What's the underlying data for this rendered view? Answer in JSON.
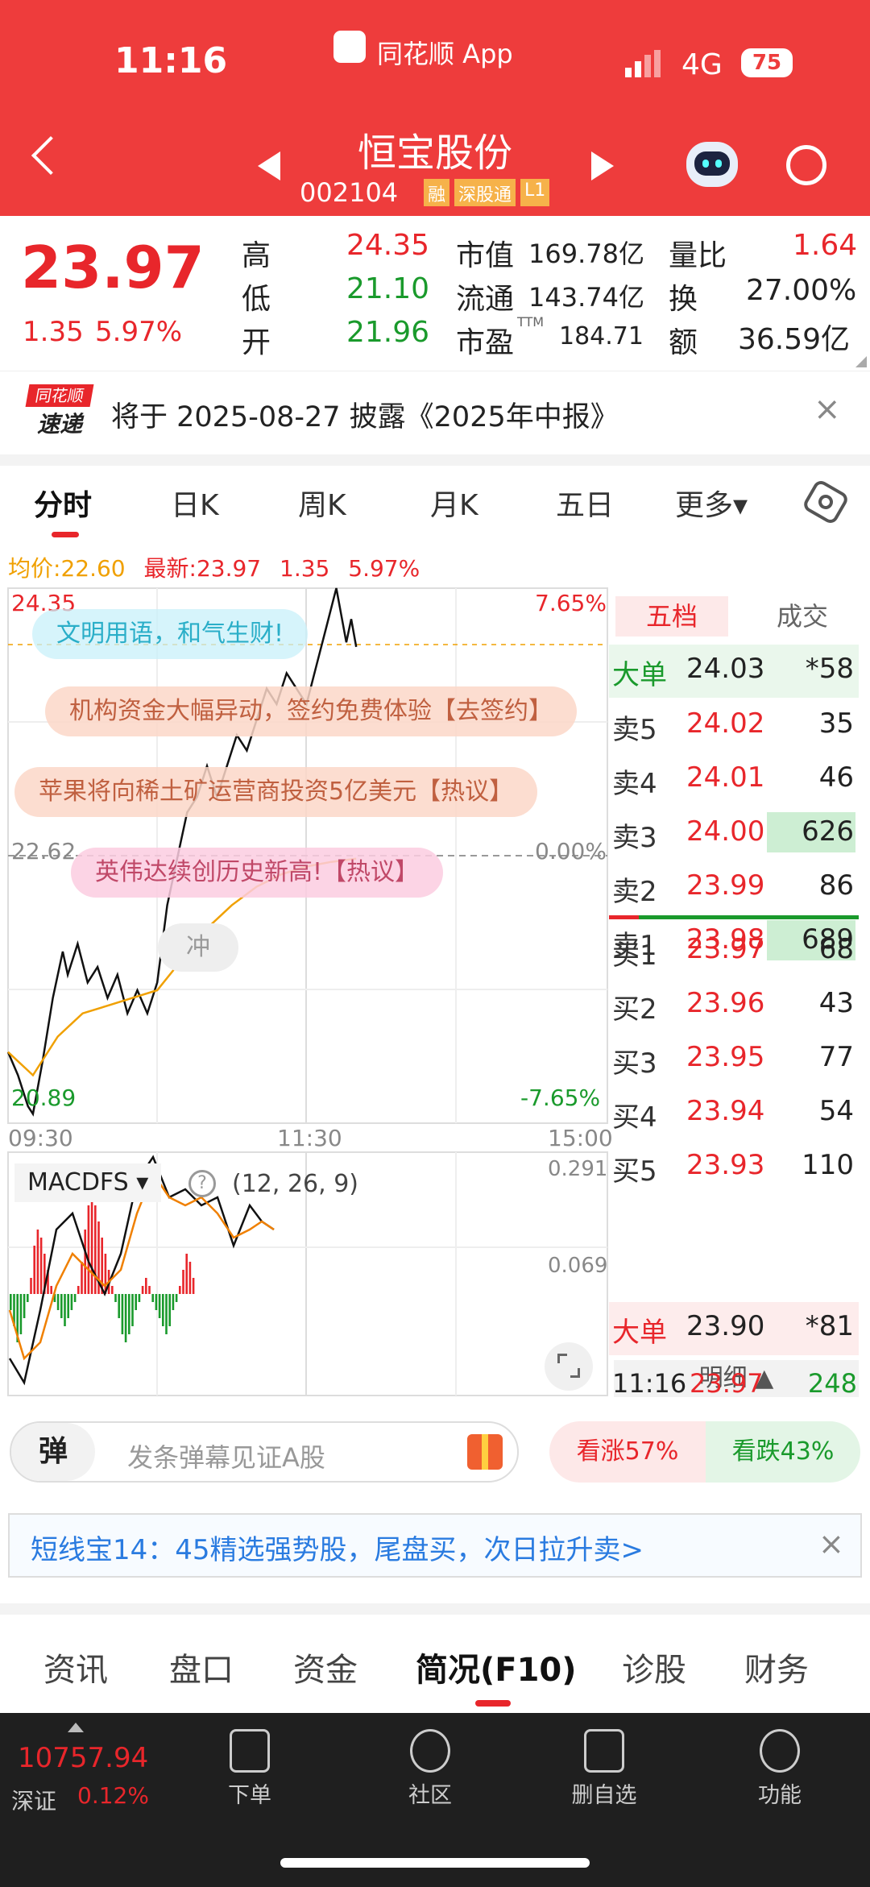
{
  "status": {
    "time": "11:16",
    "app": "同花顺 App",
    "network": "4G",
    "battery": "75"
  },
  "stock": {
    "name": "恒宝股份",
    "code": "002104",
    "tags": [
      "融",
      "深股通",
      "L1"
    ]
  },
  "quote": {
    "price": "23.97",
    "change": "1.35",
    "pct": "5.97%",
    "high_l": "高",
    "high": "24.35",
    "low_l": "低",
    "low": "21.10",
    "open_l": "开",
    "open": "21.96",
    "mcap_l": "市值",
    "mcap": "169.78亿",
    "float_l": "流通",
    "float": "143.74亿",
    "pe_l": "市盈",
    "pe_sup": "TTM",
    "pe": "184.71",
    "vr_l": "量比",
    "vr": "1.64",
    "turn_l": "换",
    "turn": "27.00%",
    "amt_l": "额",
    "amt": "36.59亿"
  },
  "notice": {
    "logo1": "同花顺",
    "logo2": "速递",
    "text": "将于 2025-08-27 披露《2025年中报》",
    "close": "×"
  },
  "tabs": [
    "分时",
    "日K",
    "周K",
    "月K",
    "五日",
    "更多▾"
  ],
  "info": {
    "avg_l": "均价:",
    "avg": "22.60",
    "latest_l": "最新:",
    "latest": "23.97",
    "chg": "1.35",
    "pct": "5.97%"
  },
  "chart": {
    "ymax": "24.35",
    "ymid": "22.62",
    "ymin": "20.89",
    "pmax": "7.65%",
    "pmid": "0.00%",
    "pmin": "-7.65%",
    "t0": "09:30",
    "t1": "11:30",
    "t2": "15:00",
    "chong": "冲"
  },
  "bubbles": [
    "文明用语，和气生财!",
    "机构资金大幅异动，签约免费体验【去签约】",
    "苹果将向稀土矿运营商投资5亿美元【热议】",
    "英伟达续创历史新高!【热议】"
  ],
  "macd": {
    "name": "MACDFS",
    "params": "(12, 26, 9)",
    "v1": "0.291",
    "v2": "0.069"
  },
  "orderbook": {
    "tab1": "五档",
    "tab2": "成交",
    "big_sell": {
      "l": "大单",
      "p": "24.03",
      "v": "*58"
    },
    "sells": [
      {
        "l": "卖5",
        "p": "24.02",
        "v": "35"
      },
      {
        "l": "卖4",
        "p": "24.01",
        "v": "46"
      },
      {
        "l": "卖3",
        "p": "24.00",
        "v": "626"
      },
      {
        "l": "卖2",
        "p": "23.99",
        "v": "86"
      },
      {
        "l": "卖1",
        "p": "23.98",
        "v": "689"
      }
    ],
    "buys": [
      {
        "l": "买1",
        "p": "23.97",
        "v": "68"
      },
      {
        "l": "买2",
        "p": "23.96",
        "v": "43"
      },
      {
        "l": "买3",
        "p": "23.95",
        "v": "77"
      },
      {
        "l": "买4",
        "p": "23.94",
        "v": "54"
      },
      {
        "l": "买5",
        "p": "23.93",
        "v": "110"
      }
    ],
    "big_buy": {
      "l": "大单",
      "p": "23.90",
      "v": "*81"
    },
    "detail_l": "明细 ▲",
    "trade": {
      "t": "11:16",
      "p": "23.97",
      "v": "248"
    }
  },
  "danmu": {
    "icon": "弹",
    "placeholder": "发条弹幕见证A股",
    "up": "看涨57%",
    "down": "看跌43%"
  },
  "banner": {
    "text": "短线宝14：45精选强势股，尾盘买，次日拉升卖>",
    "close": "×"
  },
  "subtabs": [
    "资讯",
    "盘口",
    "资金",
    "简况(F10)",
    "诊股",
    "财务"
  ],
  "bottom": {
    "index": "10757.94",
    "market": "深证",
    "pct": "0.12%",
    "items": [
      "下单",
      "社区",
      "删自选",
      "功能"
    ]
  },
  "colors": {
    "header": "#ee3c3c",
    "up": "#e8262b",
    "down": "#1a9a2c"
  }
}
